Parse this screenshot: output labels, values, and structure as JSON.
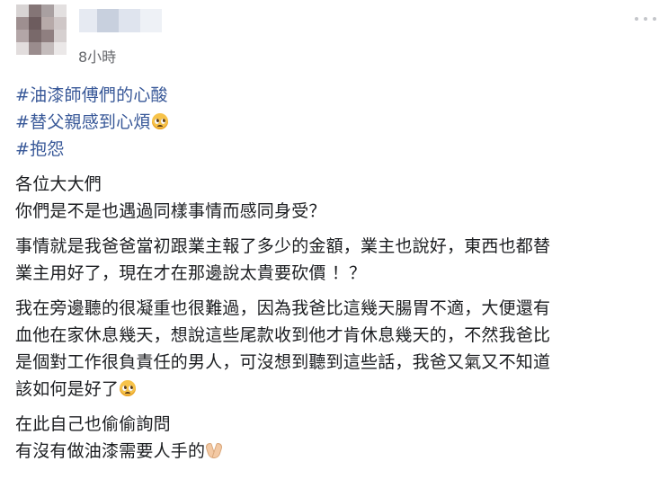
{
  "post": {
    "author": {
      "timestamp": "8小時"
    },
    "hashtags": [
      "#油漆師傅們的心酸",
      "#替父親感到心煩",
      "#抱怨"
    ],
    "paragraphs": [
      [
        "各位大大們",
        "你們是不是也遇過同樣事情而感同身受？"
      ],
      [
        "事情就是我爸爸當初跟業主報了多少的金額，業主也說好，東西也都替",
        "業主用好了，現在才在那邊說太貴要砍價 ！？"
      ],
      [
        "我在旁邊聽的很凝重也很難過，因為我爸比這幾天腸胃不適，大便還有",
        "血他在家休息幾天，想說這些尾款收到他才肯休息幾天的，不然我爸比",
        "是個對工作很負責任的男人，可沒想到聽到這些話，我爸又氣又不知道",
        "該如何是好了"
      ],
      [
        "在此自己也偷偷詢問",
        "有沒有做油漆需要人手的"
      ]
    ],
    "emojis": {
      "hashtag_1": "crying-face-icon",
      "paragraph_3_end": "crying-face-icon",
      "paragraph_4_end": "folded-hands-icon"
    },
    "colors": {
      "hashtag": "#385898",
      "text": "#1c1e21",
      "meta": "#65676b"
    }
  }
}
